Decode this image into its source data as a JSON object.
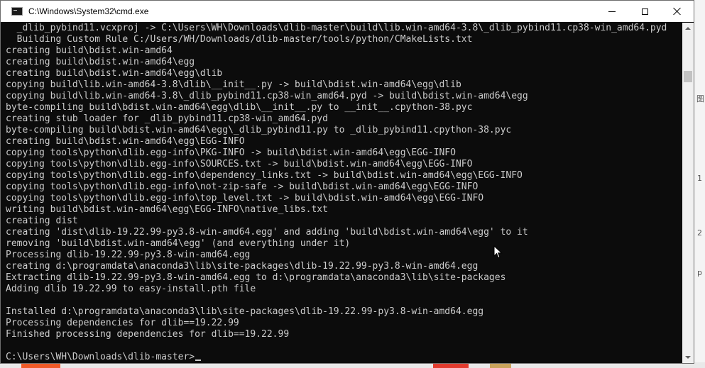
{
  "window": {
    "title": "C:\\Windows\\System32\\cmd.exe"
  },
  "background": {
    "side_marks": [
      "图",
      "1",
      "2",
      "p"
    ]
  },
  "console": {
    "lines": [
      "  _dlib_pybind11.vcxproj -> C:\\Users\\WH\\Downloads\\dlib-master\\build\\lib.win-amd64-3.8\\_dlib_pybind11.cp38-win_amd64.pyd",
      "  Building Custom Rule C:/Users/WH/Downloads/dlib-master/tools/python/CMakeLists.txt",
      "creating build\\bdist.win-amd64",
      "creating build\\bdist.win-amd64\\egg",
      "creating build\\bdist.win-amd64\\egg\\dlib",
      "copying build\\lib.win-amd64-3.8\\dlib\\__init__.py -> build\\bdist.win-amd64\\egg\\dlib",
      "copying build\\lib.win-amd64-3.8\\_dlib_pybind11.cp38-win_amd64.pyd -> build\\bdist.win-amd64\\egg",
      "byte-compiling build\\bdist.win-amd64\\egg\\dlib\\__init__.py to __init__.cpython-38.pyc",
      "creating stub loader for _dlib_pybind11.cp38-win_amd64.pyd",
      "byte-compiling build\\bdist.win-amd64\\egg\\_dlib_pybind11.py to _dlib_pybind11.cpython-38.pyc",
      "creating build\\bdist.win-amd64\\egg\\EGG-INFO",
      "copying tools\\python\\dlib.egg-info\\PKG-INFO -> build\\bdist.win-amd64\\egg\\EGG-INFO",
      "copying tools\\python\\dlib.egg-info\\SOURCES.txt -> build\\bdist.win-amd64\\egg\\EGG-INFO",
      "copying tools\\python\\dlib.egg-info\\dependency_links.txt -> build\\bdist.win-amd64\\egg\\EGG-INFO",
      "copying tools\\python\\dlib.egg-info\\not-zip-safe -> build\\bdist.win-amd64\\egg\\EGG-INFO",
      "copying tools\\python\\dlib.egg-info\\top_level.txt -> build\\bdist.win-amd64\\egg\\EGG-INFO",
      "writing build\\bdist.win-amd64\\egg\\EGG-INFO\\native_libs.txt",
      "creating dist",
      "creating 'dist\\dlib-19.22.99-py3.8-win-amd64.egg' and adding 'build\\bdist.win-amd64\\egg' to it",
      "removing 'build\\bdist.win-amd64\\egg' (and everything under it)",
      "Processing dlib-19.22.99-py3.8-win-amd64.egg",
      "creating d:\\programdata\\anaconda3\\lib\\site-packages\\dlib-19.22.99-py3.8-win-amd64.egg",
      "Extracting dlib-19.22.99-py3.8-win-amd64.egg to d:\\programdata\\anaconda3\\lib\\site-packages",
      "Adding dlib 19.22.99 to easy-install.pth file",
      "",
      "Installed d:\\programdata\\anaconda3\\lib\\site-packages\\dlib-19.22.99-py3.8-win-amd64.egg",
      "Processing dependencies for dlib==19.22.99",
      "Finished processing dependencies for dlib==19.22.99",
      ""
    ],
    "prompt": "C:\\Users\\WH\\Downloads\\dlib-master>"
  },
  "colors": {
    "console_background": "#0c0c0c",
    "console_text": "#cccccc",
    "titlebar": "#ffffff"
  },
  "icons": {
    "app": "console-icon",
    "minimize": "minimize-icon",
    "maximize": "maximize-icon",
    "close": "close-icon",
    "pointer": "mouse-pointer-icon"
  }
}
